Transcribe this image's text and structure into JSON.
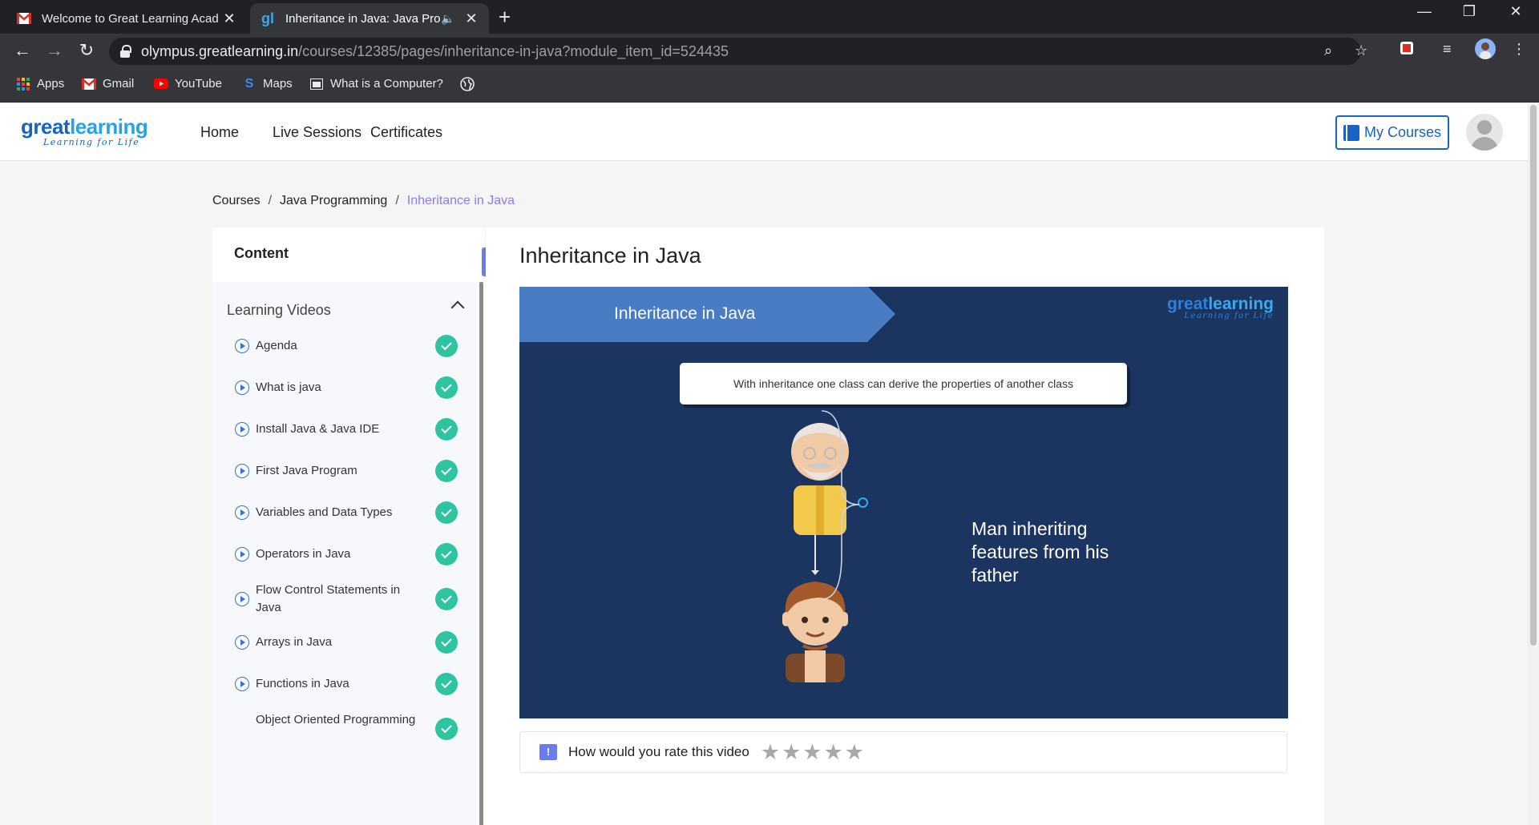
{
  "browser": {
    "tabs": [
      {
        "title": "Welcome to Great Learning Acad",
        "active": false
      },
      {
        "title": "Inheritance in Java: Java Prog",
        "active": true
      }
    ],
    "url_host": "olympus.greatlearning.in",
    "url_path": "/courses/12385/pages/inheritance-in-java?module_item_id=524435",
    "bookmarks": [
      "Apps",
      "Gmail",
      "YouTube",
      "Maps",
      "What is a Computer?"
    ]
  },
  "site": {
    "logo_main_a": "great",
    "logo_main_b": "learning",
    "logo_tagline": "Learning for Life",
    "nav": [
      "Home",
      "Live Sessions",
      "Certificates"
    ],
    "my_courses": "My Courses"
  },
  "breadcrumb": [
    "Courses",
    "Java Programming",
    "Inheritance in Java"
  ],
  "sidebar": {
    "heading": "Content",
    "section_title": "Learning Videos",
    "lessons": [
      "Agenda",
      "What is java",
      "Install Java & Java IDE",
      "First Java Program",
      "Variables and Data Types",
      "Operators in Java",
      "Flow Control Statements in Java",
      "Arrays in Java",
      "Functions in Java",
      "Object Oriented Programming"
    ],
    "collapse_label": "«"
  },
  "main": {
    "title": "Inheritance in Java",
    "slide": {
      "banner": "Inheritance in Java",
      "callout": "With inheritance one class can derive the properties of another class",
      "text": "Man inheriting features from his father"
    },
    "rating_prompt": "How would you rate this video",
    "stars": 5
  },
  "colors": {
    "accent": "#6b7cf0",
    "brand_blue": "#1a62c4",
    "complete_green": "#2ec4a0",
    "slide_bg": "#1b3560"
  }
}
